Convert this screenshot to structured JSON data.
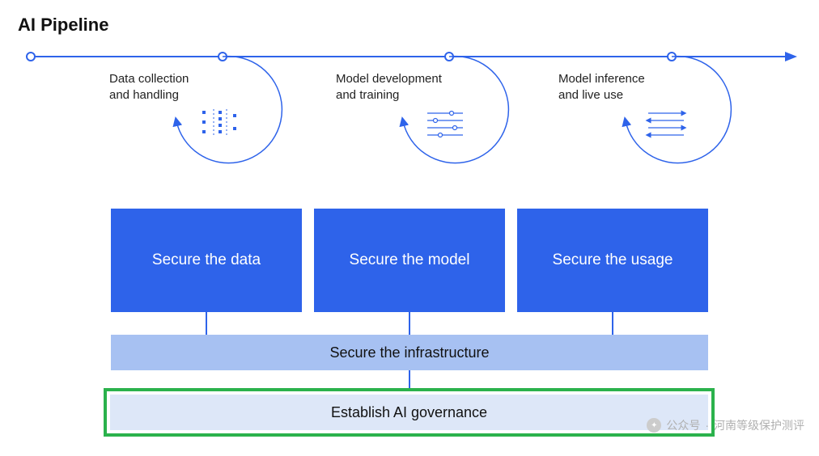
{
  "title": "AI Pipeline",
  "colors": {
    "primary_blue": "#2e63ea",
    "light_blue": "#a7c1f2",
    "pale_blue": "#dde7f8",
    "highlight_green": "#2bb24c"
  },
  "stages": [
    {
      "label_line1": "Data collection",
      "label_line2": "and handling",
      "icon": "data-points-icon"
    },
    {
      "label_line1": "Model development",
      "label_line2": "and training",
      "icon": "sliders-icon"
    },
    {
      "label_line1": "Model inference",
      "label_line2": "and live use",
      "icon": "parallel-arrows-icon"
    }
  ],
  "pillars": [
    {
      "label": "Secure the data"
    },
    {
      "label": "Secure the model"
    },
    {
      "label": "Secure the usage"
    }
  ],
  "infrastructure_label": "Secure the infrastructure",
  "governance_label": "Establish AI governance",
  "watermark": {
    "prefix": "公众号",
    "name": "河南等级保护测评"
  }
}
